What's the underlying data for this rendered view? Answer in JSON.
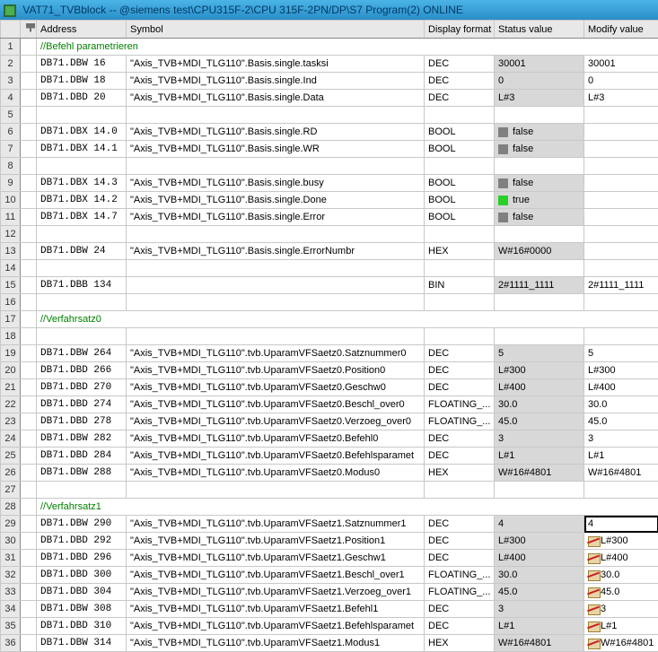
{
  "window": {
    "title": "VAT71_TVBblock -- @siemens test\\CPU315F-2\\CPU 315F-2PN/DP\\S7 Program(2)  ONLINE"
  },
  "headers": {
    "address": "Address",
    "symbol": "Symbol",
    "display_format": "Display format",
    "status_value": "Status value",
    "modify_value": "Modify value"
  },
  "comments": {
    "c1": "//Befehl parametrieren",
    "c17": "//Verfahrsatz0",
    "c28": "//Verfahrsatz1"
  },
  "rows": [
    {
      "n": "1",
      "comment": "c1"
    },
    {
      "n": "2",
      "addr": "DB71.DBW  16",
      "sym": "\"Axis_TVB+MDI_TLG110\".Basis.single.tasksi",
      "disp": "DEC",
      "stat": "30001",
      "mod": "30001"
    },
    {
      "n": "3",
      "addr": "DB71.DBW  18",
      "sym": "\"Axis_TVB+MDI_TLG110\".Basis.single.Ind",
      "disp": "DEC",
      "stat": "0",
      "mod": "0"
    },
    {
      "n": "4",
      "addr": "DB71.DBD  20",
      "sym": "\"Axis_TVB+MDI_TLG110\".Basis.single.Data",
      "disp": "DEC",
      "stat": "L#3",
      "mod": "L#3"
    },
    {
      "n": "5"
    },
    {
      "n": "6",
      "addr": "DB71.DBX  14.0",
      "sym": "\"Axis_TVB+MDI_TLG110\".Basis.single.RD",
      "disp": "BOOL",
      "stat_bool": "false"
    },
    {
      "n": "7",
      "addr": "DB71.DBX  14.1",
      "sym": "\"Axis_TVB+MDI_TLG110\".Basis.single.WR",
      "disp": "BOOL",
      "stat_bool": "false"
    },
    {
      "n": "8"
    },
    {
      "n": "9",
      "addr": "DB71.DBX  14.3",
      "sym": "\"Axis_TVB+MDI_TLG110\".Basis.single.busy",
      "disp": "BOOL",
      "stat_bool": "false"
    },
    {
      "n": "10",
      "addr": "DB71.DBX  14.2",
      "sym": "\"Axis_TVB+MDI_TLG110\".Basis.single.Done",
      "disp": "BOOL",
      "stat_bool": "true"
    },
    {
      "n": "11",
      "addr": "DB71.DBX  14.7",
      "sym": "\"Axis_TVB+MDI_TLG110\".Basis.single.Error",
      "disp": "BOOL",
      "stat_bool": "false"
    },
    {
      "n": "12"
    },
    {
      "n": "13",
      "addr": "DB71.DBW  24",
      "sym": "\"Axis_TVB+MDI_TLG110\".Basis.single.ErrorNumbr",
      "disp": "HEX",
      "stat": "W#16#0000"
    },
    {
      "n": "14"
    },
    {
      "n": "15",
      "addr": "DB71.DBB 134",
      "sym": "",
      "disp": "BIN",
      "stat": "2#1111_1111",
      "mod": "2#1111_1111"
    },
    {
      "n": "16"
    },
    {
      "n": "17",
      "comment": "c17"
    },
    {
      "n": "18"
    },
    {
      "n": "19",
      "addr": "DB71.DBW 264",
      "sym": "\"Axis_TVB+MDI_TLG110\".tvb.UparamVFSaetz0.Satznummer0",
      "disp": "DEC",
      "stat": "5",
      "mod": "5"
    },
    {
      "n": "20",
      "addr": "DB71.DBD 266",
      "sym": "\"Axis_TVB+MDI_TLG110\".tvb.UparamVFSaetz0.Position0",
      "disp": "DEC",
      "stat": "L#300",
      "mod": "L#300"
    },
    {
      "n": "21",
      "addr": "DB71.DBD 270",
      "sym": "\"Axis_TVB+MDI_TLG110\".tvb.UparamVFSaetz0.Geschw0",
      "disp": "DEC",
      "stat": "L#400",
      "mod": "L#400"
    },
    {
      "n": "22",
      "addr": "DB71.DBD 274",
      "sym": "\"Axis_TVB+MDI_TLG110\".tvb.UparamVFSaetz0.Beschl_over0",
      "disp": "FLOATING_...",
      "stat": "30.0",
      "mod": "30.0"
    },
    {
      "n": "23",
      "addr": "DB71.DBD 278",
      "sym": "\"Axis_TVB+MDI_TLG110\".tvb.UparamVFSaetz0.Verzoeg_over0",
      "disp": "FLOATING_...",
      "stat": "45.0",
      "mod": "45.0"
    },
    {
      "n": "24",
      "addr": "DB71.DBW 282",
      "sym": "\"Axis_TVB+MDI_TLG110\".tvb.UparamVFSaetz0.Befehl0",
      "disp": "DEC",
      "stat": "3",
      "mod": "3"
    },
    {
      "n": "25",
      "addr": "DB71.DBD 284",
      "sym": "\"Axis_TVB+MDI_TLG110\".tvb.UparamVFSaetz0.Befehlsparamet",
      "disp": "DEC",
      "stat": "L#1",
      "mod": "L#1"
    },
    {
      "n": "26",
      "addr": "DB71.DBW 288",
      "sym": "\"Axis_TVB+MDI_TLG110\".tvb.UparamVFSaetz0.Modus0",
      "disp": "HEX",
      "stat": "W#16#4801",
      "mod": "W#16#4801"
    },
    {
      "n": "27"
    },
    {
      "n": "28",
      "comment": "c28"
    },
    {
      "n": "29",
      "addr": "DB71.DBW 290",
      "sym": "\"Axis_TVB+MDI_TLG110\".tvb.UparamVFSaetz1.Satznummer1",
      "disp": "DEC",
      "stat": "4",
      "mod": "4",
      "selected": true
    },
    {
      "n": "30",
      "addr": "DB71.DBD 292",
      "sym": "\"Axis_TVB+MDI_TLG110\".tvb.UparamVFSaetz1.Position1",
      "disp": "DEC",
      "stat": "L#300",
      "mod": "L#300",
      "strike": true
    },
    {
      "n": "31",
      "addr": "DB71.DBD 296",
      "sym": "\"Axis_TVB+MDI_TLG110\".tvb.UparamVFSaetz1.Geschw1",
      "disp": "DEC",
      "stat": "L#400",
      "mod": "L#400",
      "strike": true
    },
    {
      "n": "32",
      "addr": "DB71.DBD 300",
      "sym": "\"Axis_TVB+MDI_TLG110\".tvb.UparamVFSaetz1.Beschl_over1",
      "disp": "FLOATING_...",
      "stat": "30.0",
      "mod": "30.0",
      "strike": true
    },
    {
      "n": "33",
      "addr": "DB71.DBD 304",
      "sym": "\"Axis_TVB+MDI_TLG110\".tvb.UparamVFSaetz1.Verzoeg_over1",
      "disp": "FLOATING_...",
      "stat": "45.0",
      "mod": "45.0",
      "strike": true
    },
    {
      "n": "34",
      "addr": "DB71.DBW 308",
      "sym": "\"Axis_TVB+MDI_TLG110\".tvb.UparamVFSaetz1.Befehl1",
      "disp": "DEC",
      "stat": "3",
      "mod": "3",
      "strike": true
    },
    {
      "n": "35",
      "addr": "DB71.DBD 310",
      "sym": "\"Axis_TVB+MDI_TLG110\".tvb.UparamVFSaetz1.Befehlsparamet",
      "disp": "DEC",
      "stat": "L#1",
      "mod": "L#1",
      "strike": true
    },
    {
      "n": "36",
      "addr": "DB71.DBW 314",
      "sym": "\"Axis_TVB+MDI_TLG110\".tvb.UparamVFSaetz1.Modus1",
      "disp": "HEX",
      "stat": "W#16#4801",
      "mod": "W#16#4801",
      "strike": true
    }
  ]
}
